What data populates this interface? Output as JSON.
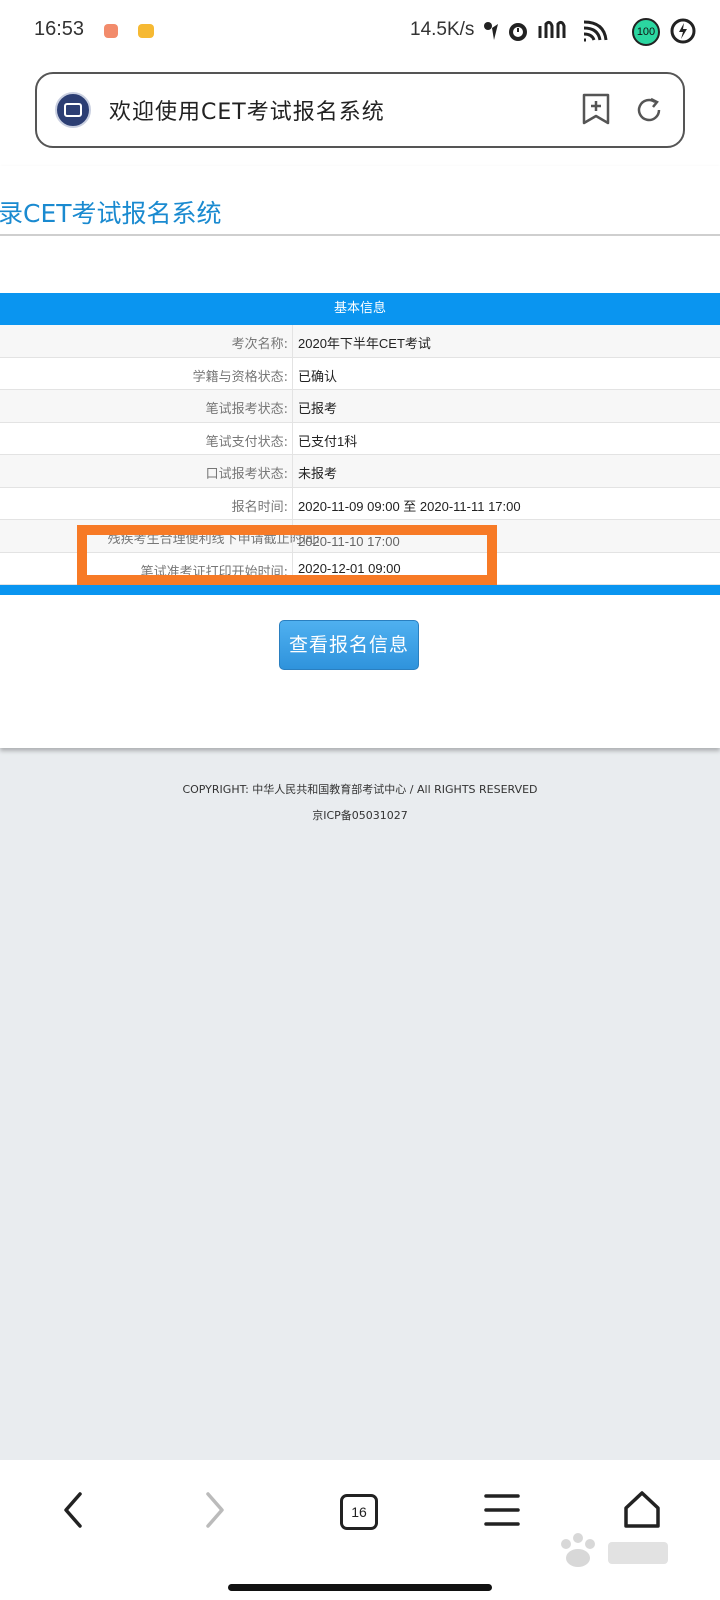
{
  "status_bar": {
    "time": "16:53",
    "net_speed": "14.5K/s",
    "battery": "100"
  },
  "address_bar": {
    "title": "欢迎使用CET考试报名系统"
  },
  "page": {
    "heading": "录CET考试报名系统",
    "table_header": "基本信息",
    "rows": [
      {
        "label": "考次名称:",
        "value": "2020年下半年CET考试"
      },
      {
        "label": "学籍与资格状态:",
        "value": "已确认"
      },
      {
        "label": "笔试报考状态:",
        "value": "已报考"
      },
      {
        "label": "笔试支付状态:",
        "value": "已支付1科"
      },
      {
        "label": "口试报考状态:",
        "value": "未报考"
      },
      {
        "label": "报名时间:",
        "value": "2020-11-09 09:00 至 2020-11-11 17:00"
      },
      {
        "label": "残疾考生合理便利线下申请截止时间:",
        "value": "2020-11-10 17:00"
      },
      {
        "label": "笔试准考证打印开始时间:",
        "value": "2020-12-01 09:00"
      }
    ],
    "view_button": "查看报名信息"
  },
  "footer": {
    "copyright": "COPYRIGHT: 中华人民共和国教育部考试中心 / All RIGHTS RESERVED",
    "icp": "京ICP备05031027"
  },
  "bottom_nav": {
    "tab_count": "16"
  },
  "colors": {
    "accent_blue": "#0a95f0",
    "heading_blue": "#1a8ad0",
    "highlight_orange": "#f77a26"
  }
}
